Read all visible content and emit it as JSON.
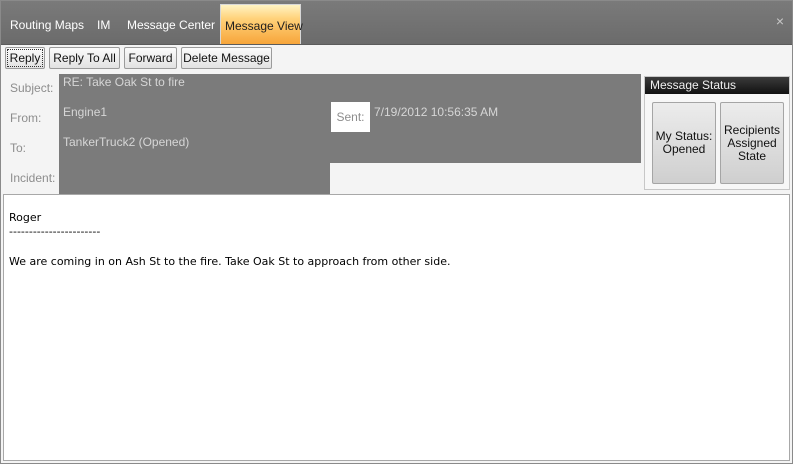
{
  "tabs": [
    {
      "label": "Routing Maps"
    },
    {
      "label": "IM"
    },
    {
      "label": "Message Center"
    },
    {
      "label": "Message View"
    }
  ],
  "close_symbol": "×",
  "toolbar": {
    "reply": "Reply",
    "reply_all": "Reply To All",
    "forward": "Forward",
    "delete": "Delete Message"
  },
  "header": {
    "subject_label": "Subject:",
    "subject_value": "RE: Take Oak St to fire",
    "from_label": "From:",
    "from_value": "Engine1",
    "to_label": "To:",
    "to_value": "TankerTruck2 (Opened)",
    "incident_label": "Incident:",
    "incident_value": "",
    "sent_label": "Sent:",
    "sent_value": "7/19/2012 10:56:35 AM"
  },
  "status": {
    "title": "Message Status",
    "my_status_line1": "My Status:",
    "my_status_line2": "Opened",
    "recipients_line1": "Recipients",
    "recipients_line2": "Assigned",
    "recipients_line3": "State"
  },
  "body": {
    "line1": "Roger",
    "line2": "-----------------------",
    "line3": "We are coming in on Ash St to the fire.  Take Oak St to approach from other side."
  },
  "colors": {
    "tabbar": "#6f6f6f",
    "active_tab": "#f7a53a",
    "header_block": "#7b7b7b",
    "status_title": "#1a1a1a"
  }
}
